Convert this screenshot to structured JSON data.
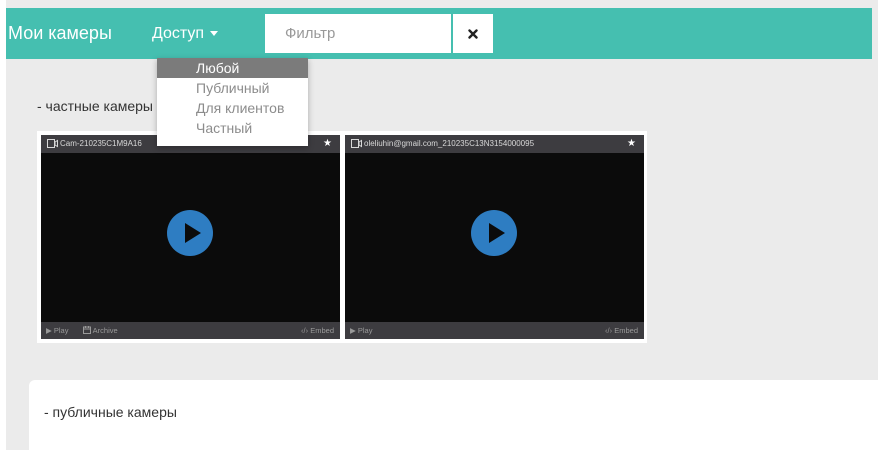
{
  "header": {
    "brand": "Мои камеры",
    "access_label": "Доступ",
    "filter_placeholder": "Фильтр",
    "clear_icon": "close-icon"
  },
  "access_menu": {
    "items": [
      "Любой",
      "Публичный",
      "Для клиентов",
      "Частный"
    ],
    "selected": "Любой"
  },
  "private_section": {
    "title": "- частные камеры",
    "cameras": [
      {
        "name": "Cam-210235C1M9A16",
        "footer_left": [
          "Play",
          "Archive"
        ],
        "footer_right": "Embed"
      },
      {
        "name": "oleliuhin@gmail.com_210235C13N3154000095",
        "footer_left": [
          "Play"
        ],
        "footer_right": "Embed"
      }
    ]
  },
  "public_section": {
    "title": "- публичные камеры"
  },
  "colors": {
    "topbar": "#45bfb0",
    "play_button": "#2e7dc2",
    "menu_active": "#7b7b7b",
    "page_bg": "#ebebeb"
  }
}
